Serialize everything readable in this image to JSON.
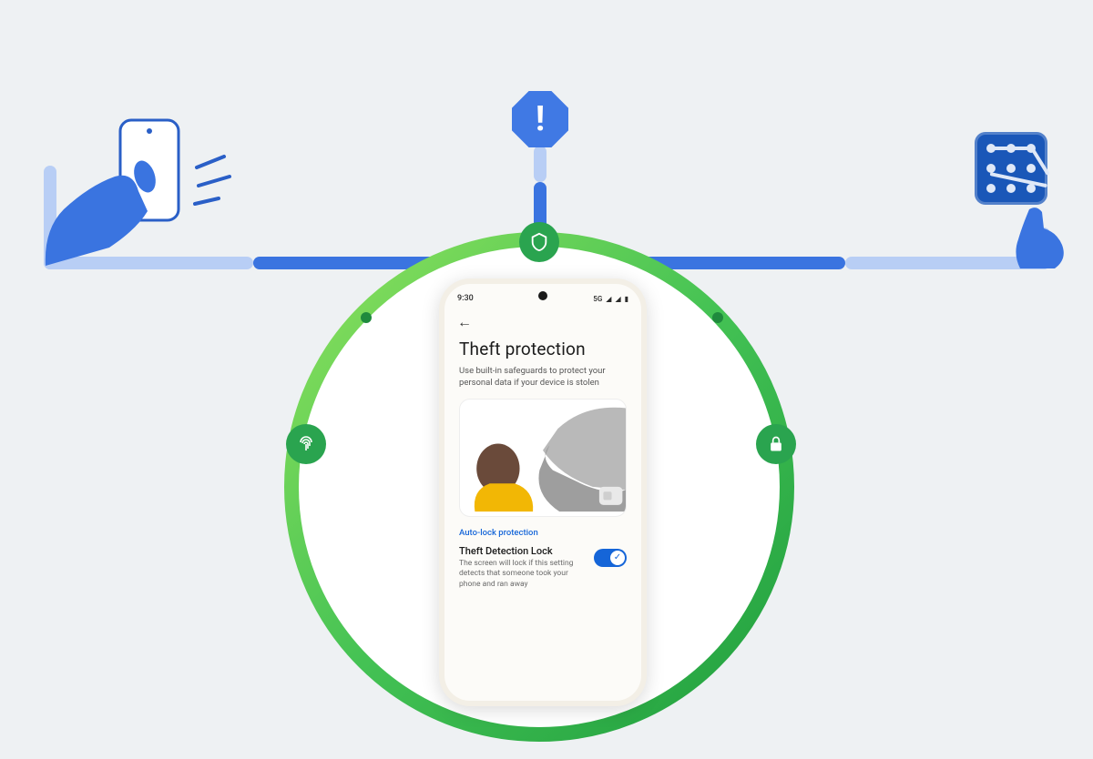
{
  "colors": {
    "accent_blue": "#4079e4",
    "line_blue_dark": "#3a74e0",
    "line_blue_light": "#b8cef5",
    "ring_green_light": "#7ed457",
    "ring_green_dark": "#2bb24b",
    "node_green": "#2aa44f",
    "toggle_on": "#1565d8",
    "section_label": "#1565d8"
  },
  "alert": {
    "glyph": "!"
  },
  "nodes": {
    "shield": "shield-icon",
    "fingerprint": "fingerprint-icon",
    "lock": "lock-icon"
  },
  "phone": {
    "status": {
      "time": "9:30",
      "network": "5G",
      "signal_glyph": "◢",
      "battery_glyph": "▮"
    },
    "back_glyph": "←",
    "title": "Theft protection",
    "subtitle": "Use built-in safeguards to protect your personal data if your device is stolen",
    "section_label": "Auto-lock protection",
    "setting": {
      "title": "Theft Detection Lock",
      "description": "The screen will lock if this setting detects that someone took your phone and ran away",
      "enabled": true,
      "check_glyph": "✓"
    }
  }
}
